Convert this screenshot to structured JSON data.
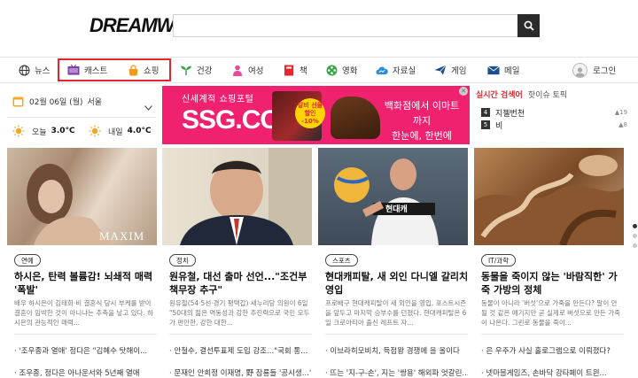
{
  "header": {
    "logo_text": "DREAMWIZ",
    "search": {
      "value": "",
      "placeholder": ""
    }
  },
  "nav": {
    "items": [
      {
        "label": "뉴스",
        "icon": "globe-icon"
      },
      {
        "label": "캐스트",
        "icon": "cast-icon"
      },
      {
        "label": "쇼핑",
        "icon": "shopping-bag-icon"
      },
      {
        "label": "건강",
        "icon": "sprout-icon"
      },
      {
        "label": "여성",
        "icon": "woman-icon"
      },
      {
        "label": "책",
        "icon": "book-icon"
      },
      {
        "label": "영화",
        "icon": "film-reel-icon"
      },
      {
        "label": "자료실",
        "icon": "cloud-icon"
      },
      {
        "label": "게임",
        "icon": "paper-plane-icon"
      },
      {
        "label": "메일",
        "icon": "mail-icon"
      }
    ],
    "login_label": "로그인"
  },
  "weather": {
    "date": "02월 06일 (월)",
    "location": "서울",
    "today_label": "오늘",
    "today_temp": "3.0°C",
    "tomorrow_label": "내일",
    "tomorrow_temp": "4.0°C"
  },
  "ad": {
    "tagline": "신세계적 쇼핑포털",
    "brand": "SSG.COM",
    "badge": "갈비 선물 할인 -10%",
    "right_line1": "백화점에서 이마트까지",
    "right_line2": "한눈에, 한번에"
  },
  "realtime": {
    "tab_active": "실시간 검색어",
    "tab_other": "핫이슈 토픽",
    "items": [
      {
        "rank": "4",
        "keyword": "지젤번천",
        "change": "▲19"
      },
      {
        "rank": "5",
        "keyword": "비",
        "change": "▲8"
      }
    ]
  },
  "articles": [
    {
      "category": "연예",
      "title": "하시은, 탄력 볼륨감! 뇌쇄적 매력 '폭발'",
      "desc": "배우 하시은이 김태희·비 결혼식 당시 부케를 받아 결혼이 임박한 것이 아니냐는 추측을 낳고 있다. 하시은의 관능적인 매력...",
      "subs": [
        "· '조우종과 열애' 정다은 \"김혜수 탓해이...",
        "· 조우종, 정다은 아나운서와 5년째 열애"
      ],
      "image_text": "MAXIM"
    },
    {
      "category": "정치",
      "title": "원유철, 대선 출마 선언...\"조건부 책무장 추구\"",
      "desc": "원유철(54·5선·경기 평택갑) 새누리당 의원이 6일 \"50대의 젊은 역동성과 강한 추진력으로 국민 모두가 편안한, 강한 대한...",
      "subs": [
        "· 안철수, 결선투표제 도입 강조...\"국회 통...",
        "· 문재인 안희정 이재명, 野 잠룡들 '공시생...'"
      ],
      "image_text": ""
    },
    {
      "category": "스포츠",
      "title": "현대캐피탈, 새 외인 다니엘 갈리치 영입",
      "desc": "프로배구 현대캐피탈이 새 외인을 영입, 포스트시즌을 앞두고 마지막 승부수를 던졌다. 현대캐피탈은 6일 크로아티아 출신 레프트 자...",
      "subs": [
        "· 이브라히모비치, 득점왕 경쟁에 을 올이다",
        "· 뜨는 '지-구-손', 지는 '쌍용' 해외파 엇갈린..."
      ],
      "image_text": "현대캐"
    },
    {
      "category": "IT/과학",
      "title": "동물을 죽이지 않는 '바람직한' 가죽 가방의 정체",
      "desc": "동물이 아니라 '버섯'으로 가죽을 만든다? 말이 안 될 것 같은 얘기지만 곧 실제로 버섯으로 만든 가죽이 나온다. 그린로 동물을 죽이...",
      "subs": [
        "· 은 우주가 사실 홀로그램으로 이뤄졌다?",
        "· 넷마블게임즈, 손바닥 강타페이 트윈..."
      ],
      "image_text": ""
    }
  ],
  "colors": {
    "accent_red": "#e5262e",
    "ad_pink": "#f0216f",
    "dark": "#2b2b2b"
  }
}
